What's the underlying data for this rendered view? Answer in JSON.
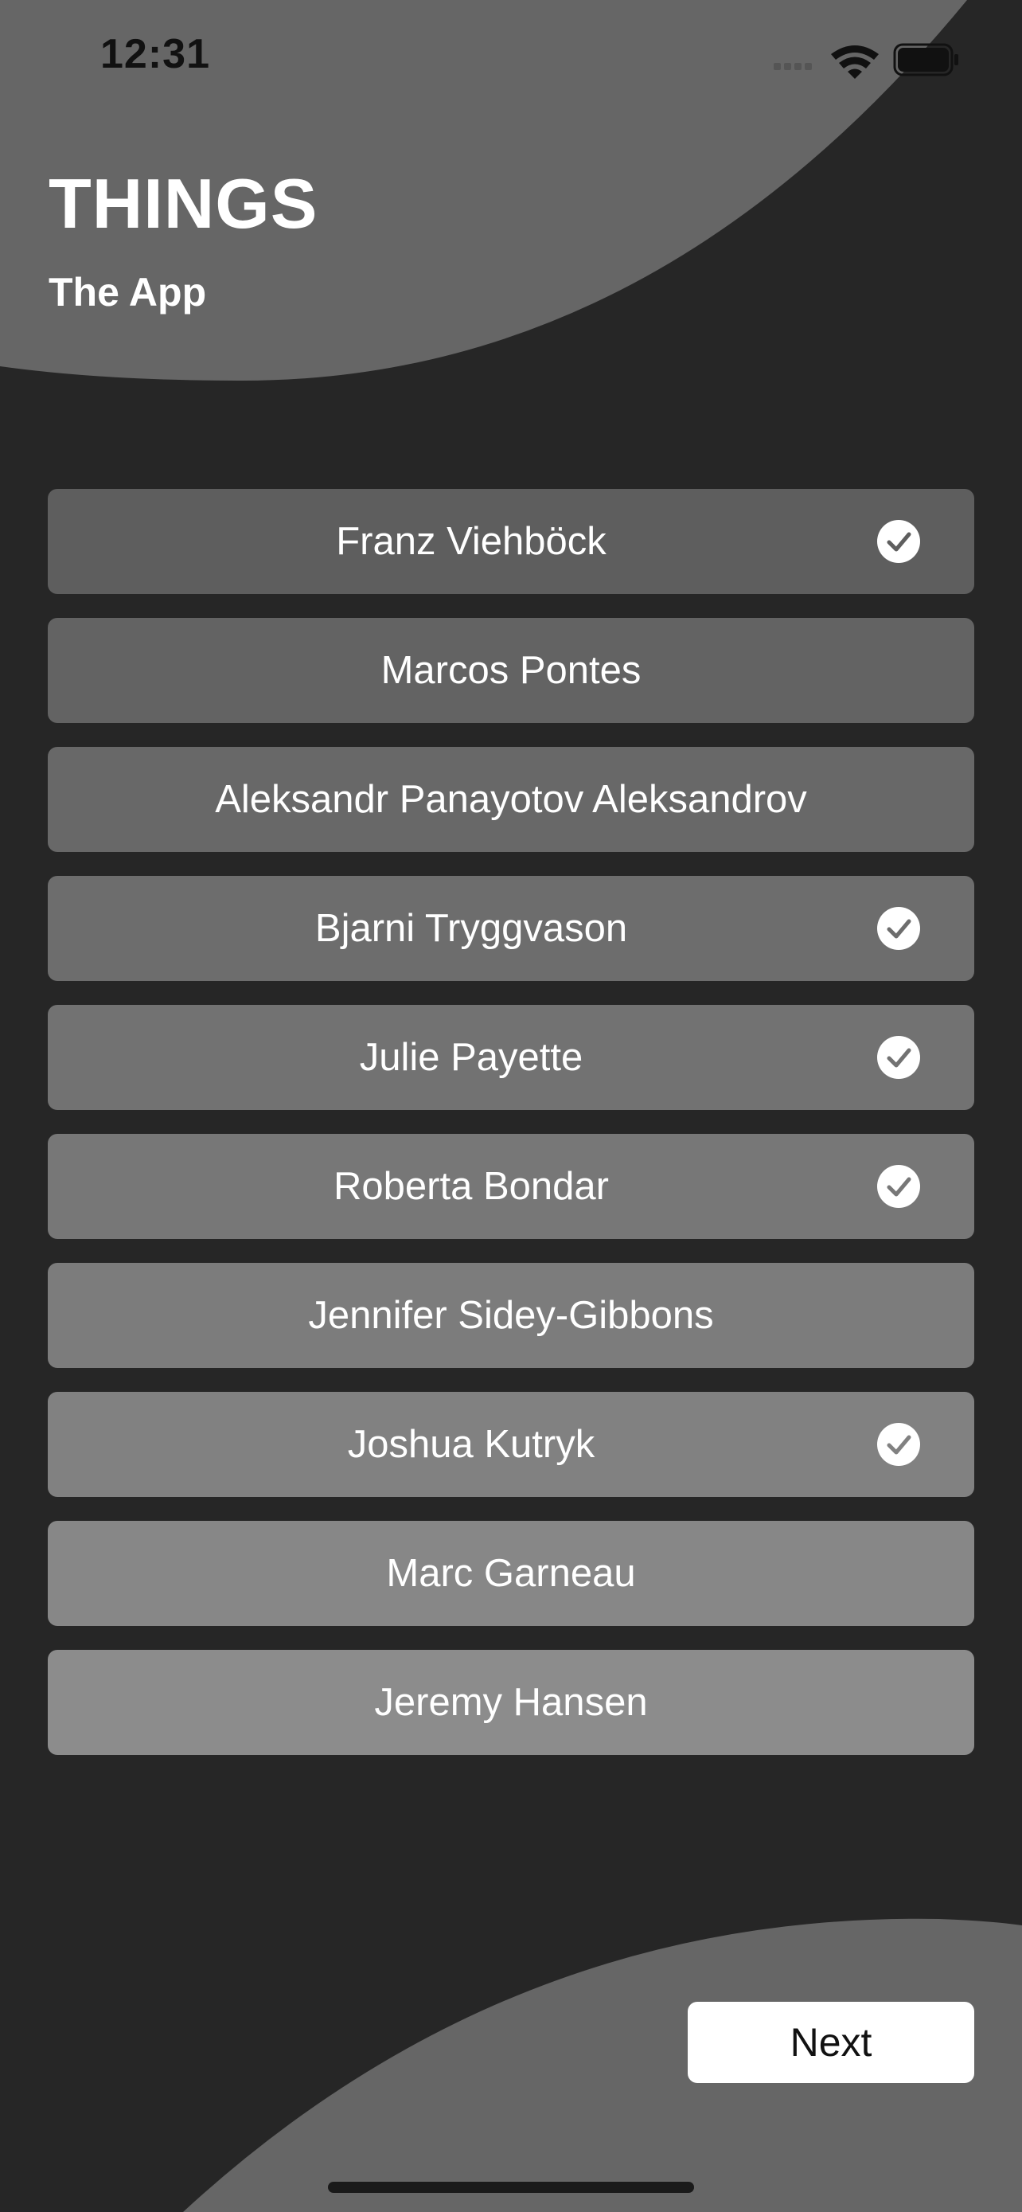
{
  "status_bar": {
    "time": "12:31",
    "icons": [
      "cellular-signal-icon",
      "wifi-icon",
      "battery-icon"
    ]
  },
  "header": {
    "title": "THINGS",
    "subtitle": "The App"
  },
  "list": {
    "items": [
      {
        "label": "Franz Viehböck",
        "checked": true,
        "color": "#5e5e5e"
      },
      {
        "label": "Marcos Pontes",
        "checked": false,
        "color": "#636363"
      },
      {
        "label": "Aleksandr Panayotov Aleksandrov",
        "checked": false,
        "color": "#686868"
      },
      {
        "label": "Bjarni Tryggvason",
        "checked": true,
        "color": "#6d6d6d"
      },
      {
        "label": "Julie Payette",
        "checked": true,
        "color": "#727272"
      },
      {
        "label": "Roberta Bondar",
        "checked": true,
        "color": "#777777"
      },
      {
        "label": "Jennifer Sidey-Gibbons",
        "checked": false,
        "color": "#7c7c7c"
      },
      {
        "label": "Joshua Kutryk",
        "checked": true,
        "color": "#818181"
      },
      {
        "label": "Marc Garneau",
        "checked": false,
        "color": "#878787"
      },
      {
        "label": "Jeremy Hansen",
        "checked": false,
        "color": "#8c8c8c"
      }
    ]
  },
  "footer": {
    "next_label": "Next"
  },
  "colors": {
    "background": "#262626",
    "shape": "#666666",
    "button": "#ffffff",
    "check": "#ffffff"
  }
}
